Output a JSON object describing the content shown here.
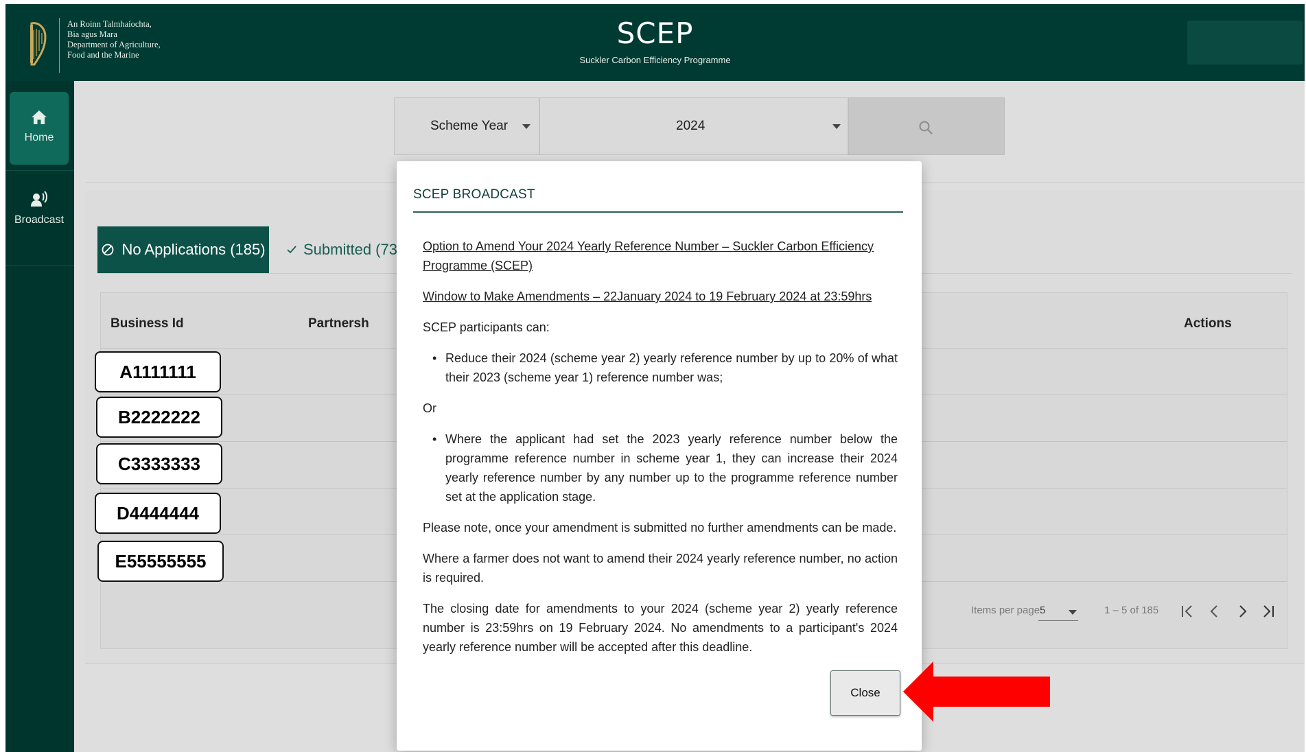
{
  "header": {
    "dept_lines": [
      "An Roinn Talmhaíochta,",
      "Bia agus Mara",
      "Department of Agriculture,",
      "Food and the Marine"
    ],
    "title": "SCEP",
    "subtitle": "Suckler Carbon Efficiency Programme"
  },
  "sidebar": {
    "items": [
      {
        "label": "Home",
        "icon": "home-icon",
        "active": true
      },
      {
        "label": "Broadcast",
        "icon": "broadcast-icon",
        "active": false
      }
    ]
  },
  "filters": {
    "scheme_label": "Scheme Year",
    "year_value": "2024",
    "search_icon": "search-icon"
  },
  "tabs": {
    "no_applications": "No Applications (185)",
    "submitted": "Submitted (73)"
  },
  "table": {
    "headers": {
      "business_id": "Business Id",
      "partnership": "Partnersh",
      "actions": "Actions"
    },
    "business_ids": [
      "A1111111",
      "B2222222",
      "C3333333",
      "D4444444",
      "E55555555"
    ]
  },
  "pager": {
    "items_per_page_label": "Items per page:",
    "items_per_page_value": "5",
    "range": "1 – 5 of 185"
  },
  "modal": {
    "title": "SCEP BROADCAST",
    "heading1": "Option to Amend Your 2024 Yearly Reference Number – Suckler Carbon Efficiency Programme (SCEP)",
    "heading2": "Window to Make Amendments – 22January 2024 to 19 February 2024 at 23:59hrs",
    "intro": "SCEP participants can:",
    "bullet1": "Reduce their 2024 (scheme year 2) yearly reference number by up to 20% of what their 2023 (scheme year 1) reference number was;",
    "or": "Or",
    "bullet2": "Where the applicant had set the 2023 yearly reference number below the programme reference number in scheme year 1, they can increase their 2024 yearly reference number by any number up to the programme reference number set at the application stage.",
    "note": "Please note, once your amendment is submitted no further amendments can be made.",
    "no_action": "Where a farmer does not want to amend their 2024 yearly reference number, no action is required.",
    "closing": "The closing date for amendments to your 2024 (scheme year 2) yearly reference number is 23:59hrs on 19 February 2024. No amendments to a participant's 2024 yearly reference number will be accepted after this deadline.",
    "close_label": "Close"
  },
  "colors": {
    "header_bg": "#003b33",
    "sidebar_bg": "#00352e",
    "active_tab": "#0c5248",
    "arrow": "#ff0000"
  }
}
